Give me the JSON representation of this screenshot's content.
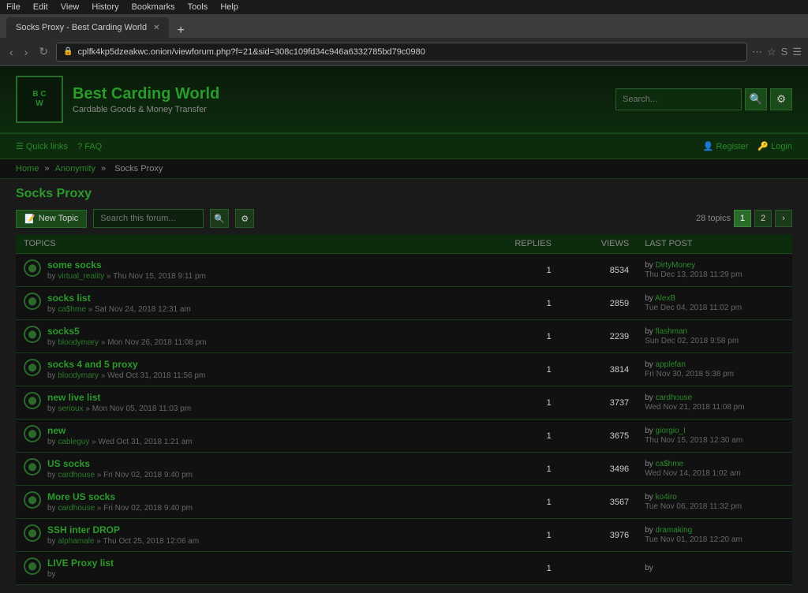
{
  "browser": {
    "menu_items": [
      "File",
      "Edit",
      "View",
      "History",
      "Bookmarks",
      "Tools",
      "Help"
    ],
    "tab_title": "Socks Proxy - Best Carding World",
    "url": "cplfk4kp5dzeakwc.onion/viewforum.php?f=21&sid=308c109fd34c946a6332785bd79c0980",
    "nav_back": "‹",
    "nav_forward": "›",
    "nav_reload": "↻",
    "addr_icons": [
      "☰",
      "★",
      "S"
    ]
  },
  "header": {
    "logo_text": "B C W",
    "site_title": "Best Carding World",
    "site_subtitle": "Cardable Goods & Money Transfer",
    "search_placeholder": "Search..."
  },
  "top_nav": {
    "quick_links": "Quick links",
    "faq": "FAQ",
    "register": "Register",
    "login": "Login"
  },
  "breadcrumb": {
    "home": "Home",
    "anonymity": "Anonymity",
    "current": "Socks Proxy"
  },
  "forum": {
    "page_title": "Socks Proxy",
    "new_topic_btn": "New Topic",
    "search_placeholder": "Search this forum...",
    "topics_count": "28 topics",
    "columns": {
      "topics": "TOPICS",
      "replies": "REPLIES",
      "views": "VIEWS",
      "last_post": "LAST POST"
    },
    "pagination": {
      "current": 1,
      "pages": [
        "1",
        "2"
      ]
    },
    "topics": [
      {
        "title": "some socks",
        "author": "virtual_reality",
        "date": "Thu Nov 15, 2018 9:11 pm",
        "replies": "1",
        "views": "8534",
        "last_post_by": "DirtyMoney",
        "last_post_date": "Thu Dec 13, 2018 11:29 pm"
      },
      {
        "title": "socks list",
        "author": "ca$hme",
        "date": "Sat Nov 24, 2018 12:31 am",
        "replies": "1",
        "views": "2859",
        "last_post_by": "AlexB",
        "last_post_date": "Tue Dec 04, 2018 11:02 pm"
      },
      {
        "title": "socks5",
        "author": "bloodymary",
        "date": "Mon Nov 26, 2018 11:08 pm",
        "replies": "1",
        "views": "2239",
        "last_post_by": "flashman",
        "last_post_date": "Sun Dec 02, 2018 9:58 pm"
      },
      {
        "title": "socks 4 and 5 proxy",
        "author": "bloodymary",
        "date": "Wed Oct 31, 2018 11:56 pm",
        "replies": "1",
        "views": "3814",
        "last_post_by": "applefan",
        "last_post_date": "Fri Nov 30, 2018 5:38 pm"
      },
      {
        "title": "new live list",
        "author": "serioux",
        "date": "Mon Nov 05, 2018 11:03 pm",
        "replies": "1",
        "views": "3737",
        "last_post_by": "cardhouse",
        "last_post_date": "Wed Nov 21, 2018 11:08 pm"
      },
      {
        "title": "new",
        "author": "cableguy",
        "date": "Wed Oct 31, 2018 1:21 am",
        "replies": "1",
        "views": "3675",
        "last_post_by": "giorgio_I",
        "last_post_date": "Thu Nov 15, 2018 12:30 am"
      },
      {
        "title": "US socks",
        "author": "cardhouse",
        "date": "Fri Nov 02, 2018 9:40 pm",
        "replies": "1",
        "views": "3496",
        "last_post_by": "ca$hme",
        "last_post_date": "Wed Nov 14, 2018 1:02 am"
      },
      {
        "title": "More US socks",
        "author": "cardhouse",
        "date": "Fri Nov 02, 2018 9:40 pm",
        "replies": "1",
        "views": "3567",
        "last_post_by": "ko4iro",
        "last_post_date": "Tue Nov 06, 2018 11:32 pm"
      },
      {
        "title": "SSH inter DROP",
        "author": "alphamale",
        "date": "Thu Oct 25, 2018 12:06 am",
        "replies": "1",
        "views": "3976",
        "last_post_by": "dramaking",
        "last_post_date": "Tue Nov 01, 2018 12:20 am"
      },
      {
        "title": "LIVE Proxy list",
        "author": "",
        "date": "",
        "replies": "1",
        "views": "",
        "last_post_by": "",
        "last_post_date": ""
      }
    ]
  }
}
